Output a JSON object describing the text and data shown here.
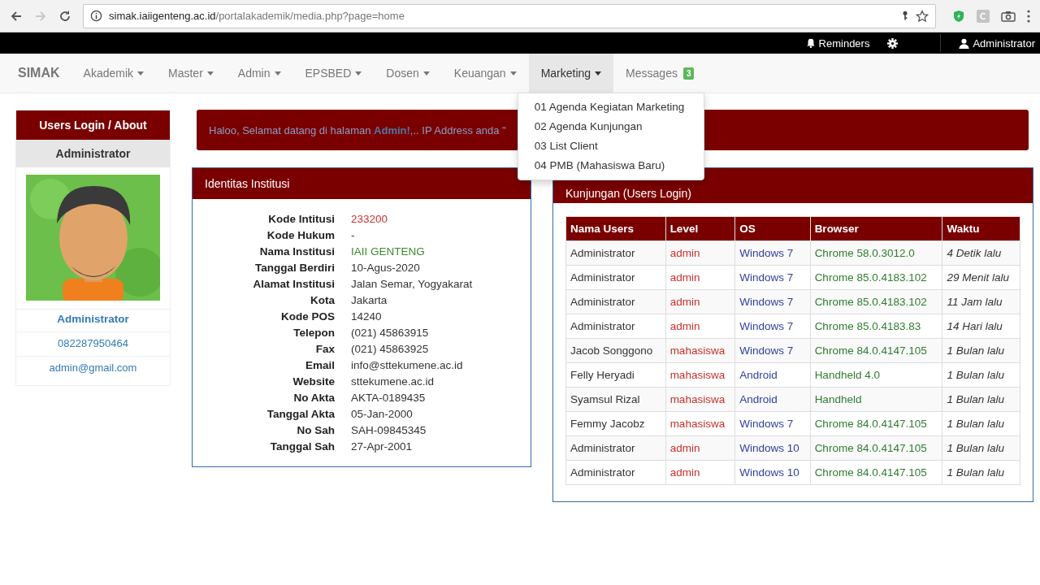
{
  "browser": {
    "url_host": "simak.iaiigenteng.ac.id",
    "url_path": "/portalakademik/media.php?page=home",
    "back_disabled": false,
    "forward_disabled": true
  },
  "topbar": {
    "reminders": "Reminders",
    "user": "Administrator"
  },
  "navbar": {
    "brand": "SIMAK",
    "menus": [
      {
        "label": "Akademik",
        "selected": false
      },
      {
        "label": "Master",
        "selected": false
      },
      {
        "label": "Admin",
        "selected": false
      },
      {
        "label": "EPSBED",
        "selected": false
      },
      {
        "label": "Dosen",
        "selected": false
      },
      {
        "label": "Keuangan",
        "selected": false
      },
      {
        "label": "Marketing",
        "selected": true
      }
    ],
    "messages": {
      "label": "Messages",
      "badge": "3"
    },
    "dropdown": [
      "01 Agenda Kegiatan Marketing",
      "02 Agenda Kunjungan",
      "03 List Client",
      "04 PMB (Mahasiswa Baru)"
    ]
  },
  "sidebar": {
    "title": "Users Login / About",
    "subtitle": "Administrator",
    "name": "Administrator",
    "phone": "082287950464",
    "email": "admin@gmail.com"
  },
  "welcome": "Haloo, Selamat datang di halaman **Admin!**,.. IP Address anda \"",
  "institusi": {
    "title": "Identitas Institusi",
    "rows": [
      {
        "label": "Kode Intitusi",
        "value": "233200",
        "color": "#c9302c"
      },
      {
        "label": "Kode Hukum",
        "value": "-"
      },
      {
        "label": "Nama Institusi",
        "value": "IAII GENTENG",
        "color": "#3c8a2e"
      },
      {
        "label": "Tanggal Berdiri",
        "value": "10-Agus-2020"
      },
      {
        "label": "Alamat Institusi",
        "value": "Jalan Semar, Yogyakarat"
      },
      {
        "label": "Kota",
        "value": "Jakarta"
      },
      {
        "label": "Kode POS",
        "value": "14240"
      },
      {
        "label": "Telepon",
        "value": "(021) 45863915"
      },
      {
        "label": "Fax",
        "value": "(021) 45863925"
      },
      {
        "label": "Email",
        "value": "info@sttekumene.ac.id"
      },
      {
        "label": "Website",
        "value": "sttekumene.ac.id"
      },
      {
        "label": "No Akta",
        "value": "AKTA-0189435"
      },
      {
        "label": "Tanggal Akta",
        "value": "05-Jan-2000"
      },
      {
        "label": "No Sah",
        "value": "SAH-09845345"
      },
      {
        "label": "Tanggal Sah",
        "value": "27-Apr-2001"
      }
    ]
  },
  "kunjungan": {
    "title": "Kunjungan (Users Login)",
    "columns": [
      {
        "label": "Nama Users",
        "kind": "name"
      },
      {
        "label": "Level",
        "kind": "level"
      },
      {
        "label": "OS",
        "kind": "os"
      },
      {
        "label": "Browser",
        "kind": "browser"
      },
      {
        "label": "Waktu",
        "kind": "time"
      }
    ],
    "rows": [
      [
        "Administrator",
        "admin",
        "Windows 7",
        "Chrome 58.0.3012.0",
        "4 Detik lalu"
      ],
      [
        "Administrator",
        "admin",
        "Windows 7",
        "Chrome 85.0.4183.102",
        "29 Menit lalu"
      ],
      [
        "Administrator",
        "admin",
        "Windows 7",
        "Chrome 85.0.4183.102",
        "11 Jam lalu"
      ],
      [
        "Administrator",
        "admin",
        "Windows 7",
        "Chrome 85.0.4183.83",
        "14 Hari lalu"
      ],
      [
        "Jacob Songgono",
        "mahasiswa",
        "Windows 7",
        "Chrome 84.0.4147.105",
        "1 Bulan lalu"
      ],
      [
        "Felly Heryadi",
        "mahasiswa",
        "Android",
        "Handheld 4.0",
        "1 Bulan lalu"
      ],
      [
        "Syamsul Rizal",
        "mahasiswa",
        "Android",
        "Handheld",
        "1 Bulan lalu"
      ],
      [
        "Femmy Jacobz",
        "mahasiswa",
        "Windows 7",
        "Chrome 84.0.4147.105",
        "1 Bulan lalu"
      ],
      [
        "Administrator",
        "admin",
        "Windows 10",
        "Chrome 84.0.4147.105",
        "1 Bulan lalu"
      ],
      [
        "Administrator",
        "admin",
        "Windows 10",
        "Chrome 84.0.4147.105",
        "1 Bulan lalu"
      ]
    ]
  }
}
